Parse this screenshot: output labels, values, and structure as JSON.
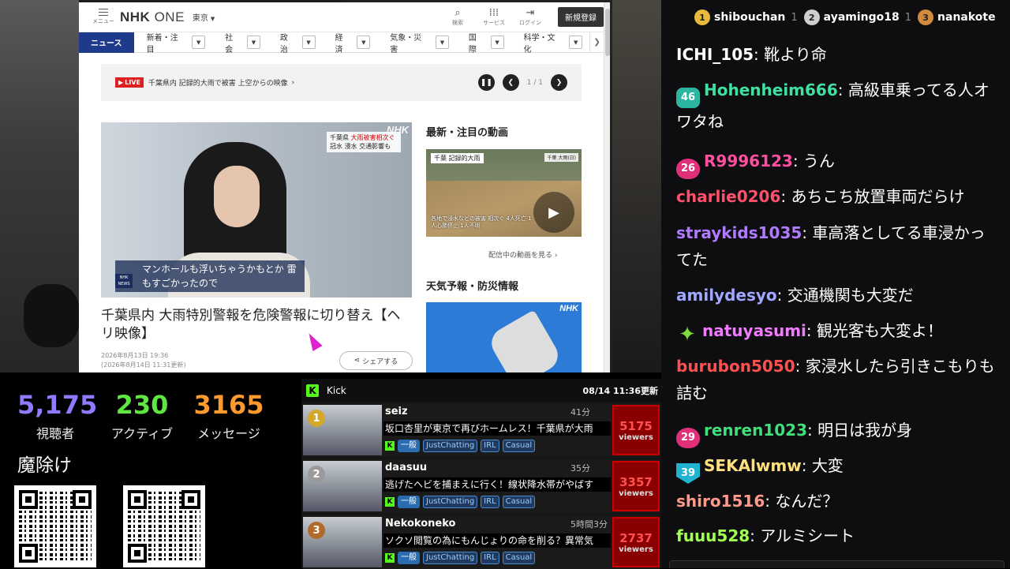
{
  "browser": {
    "menu_label": "メニュー",
    "logo_main": "NHK",
    "logo_sub": "ONE",
    "region": "東京",
    "search_label": "検索",
    "service_label": "サービス",
    "login_label": "ログイン",
    "signup_label": "新規登録",
    "nav": {
      "active": "ニュース",
      "items": [
        "新着・注目",
        "社会",
        "政治",
        "経済",
        "気象・災害",
        "国際",
        "科学・文化"
      ]
    },
    "live": {
      "badge": "LIVE",
      "text": "千葉県内 記録的大雨で被害 上空からの映像",
      "page": "1 / 1"
    },
    "hero": {
      "tag_line1": "千葉県",
      "tag_red": "大雨被害相次ぐ",
      "tag_line2": "冠水 浸水 交通影響も",
      "nhk": "NHK",
      "caption": "マンホールも浮いちゃうかもとか 雷もすごかったので",
      "news_mark": "NHK NEWS"
    },
    "headline": "千葉県内 大雨特別警報を危険警報に切り替え【ヘリ映像】",
    "date1": "2026年8月13日 19:36",
    "date2": "(2026年8月14日 11:31更新)",
    "share_label": "シェアする",
    "side": {
      "title1": "最新・注目の動画",
      "thumb_label": "千葉 記録的大雨",
      "thumb_label2": "千葉 大雨(日)",
      "thumb_caption": "各地で浸水などの被害 相次ぐ 4人死亡 1人心肺停止 1人不明",
      "more": "配信中の動画を見る",
      "title2": "天気予報・防災情報",
      "wx_nhk": "NHK"
    }
  },
  "stats": {
    "viewers": "5,175",
    "viewers_label": "視聴者",
    "active": "230",
    "active_label": "アクティブ",
    "messages": "3165",
    "messages_label": "メッセージ",
    "mayoke": "魔除け",
    "colors": {
      "viewers": "#8f7bff",
      "active": "#5fe640",
      "messages": "#ff9a2e"
    }
  },
  "kick": {
    "title": "Kick",
    "updated": "08/14 11:36更新",
    "rows": [
      {
        "rank": "1",
        "rank_color": "#d4a82a",
        "name": "seiz",
        "duration": "41分",
        "title": "坂口杏里が東京で再びホームレス！千葉県が大雨",
        "lang": "一般",
        "tags": [
          "JustChatting",
          "IRL",
          "Casual"
        ],
        "viewers": "5175",
        "viewers_label": "viewers"
      },
      {
        "rank": "2",
        "rank_color": "#9a9a9a",
        "name": "daasuu",
        "duration": "35分",
        "title": "逃げたヘビを捕まえに行く！線状降水帯がやばす",
        "lang": "一般",
        "tags": [
          "JustChatting",
          "IRL",
          "Casual"
        ],
        "viewers": "3357",
        "viewers_label": "viewers"
      },
      {
        "rank": "3",
        "rank_color": "#b06b2a",
        "name": "Nekokoneko",
        "duration": "5時間3分",
        "title": "ソクソ閲覧の為にもんじょりの命を削る？異常気",
        "lang": "一般",
        "tags": [
          "JustChatting",
          "IRL",
          "Casual"
        ],
        "viewers": "2737",
        "viewers_label": "viewers"
      }
    ]
  },
  "chat": {
    "top_fans": [
      {
        "rank": "1",
        "name": "shibouchan",
        "count": "1",
        "medal_color": "#e8b93a"
      },
      {
        "rank": "2",
        "name": "ayamingo18",
        "count": "1",
        "medal_color": "#cfcfcf"
      },
      {
        "rank": "3",
        "name": "nanakote",
        "count": "",
        "medal_color": "#d28a3c"
      }
    ],
    "messages": [
      {
        "user": "ICHI_105",
        "color": "#ffffff",
        "text": "靴より命",
        "badge": ""
      },
      {
        "user": "Hohenheim666",
        "color": "#3fe0a0",
        "text": "高級車乗ってる人オワタね",
        "badge": "hex",
        "badge_text": "46"
      },
      {
        "user": "R9996123",
        "color": "#ff4fa0",
        "text": "うん",
        "badge": "drop",
        "badge_text": "26"
      },
      {
        "user": "charlie0206",
        "color": "#ff4f6a",
        "text": "あちこち放置車両だらけ",
        "badge": ""
      },
      {
        "user": "straykids1035",
        "color": "#b07bff",
        "text": "車高落としてる車浸かってた",
        "badge": ""
      },
      {
        "user": "amilydesyo",
        "color": "#a0a8ff",
        "text": "交通機関も大変だ",
        "badge": ""
      },
      {
        "user": "natuyasumi",
        "color": "#f07bff",
        "text": "観光客も大変よ！",
        "badge": "star",
        "badge_text": "✦"
      },
      {
        "user": "burubon5050",
        "color": "#ff4f4f",
        "text": "家浸水したら引きこもりも詰む",
        "badge": ""
      },
      {
        "user": "renren1023",
        "color": "#3fe07a",
        "text": "明日は我が身",
        "badge": "drop",
        "badge_text": "29"
      },
      {
        "user": "SEKAlwmw",
        "color": "#ffe07a",
        "text": "大変",
        "badge": "shield",
        "badge_text": "39"
      },
      {
        "user": "shiro1516",
        "color": "#ff9a8a",
        "text": "なんだ？",
        "badge": ""
      },
      {
        "user": "fuuu528",
        "color": "#a0ff4f",
        "text": "アルミシート",
        "badge": ""
      }
    ]
  }
}
